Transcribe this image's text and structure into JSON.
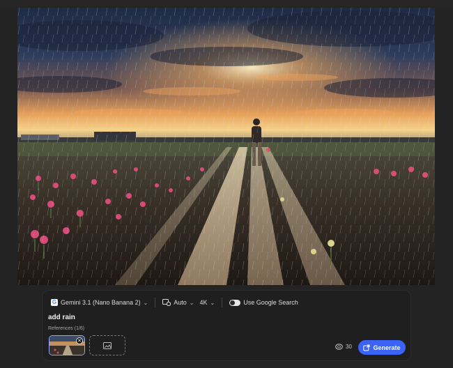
{
  "toolbar": {
    "model_label": "Gemini 3.1 (Nano Banana 2)",
    "model_logo_letter": "G",
    "aspect_label": "Auto",
    "resolution_label": "4K",
    "google_search_label": "Use Google Search",
    "google_search_enabled": true
  },
  "prompt": {
    "text": "add rain"
  },
  "references": {
    "label": "References (1/6)",
    "count": 1,
    "max": 6
  },
  "credits": {
    "value": "30"
  },
  "generate_button": {
    "label": "Generate"
  },
  "colors": {
    "accent": "#3b63f6",
    "panel_bg": "#1f1f1f",
    "page_bg": "#232323"
  }
}
